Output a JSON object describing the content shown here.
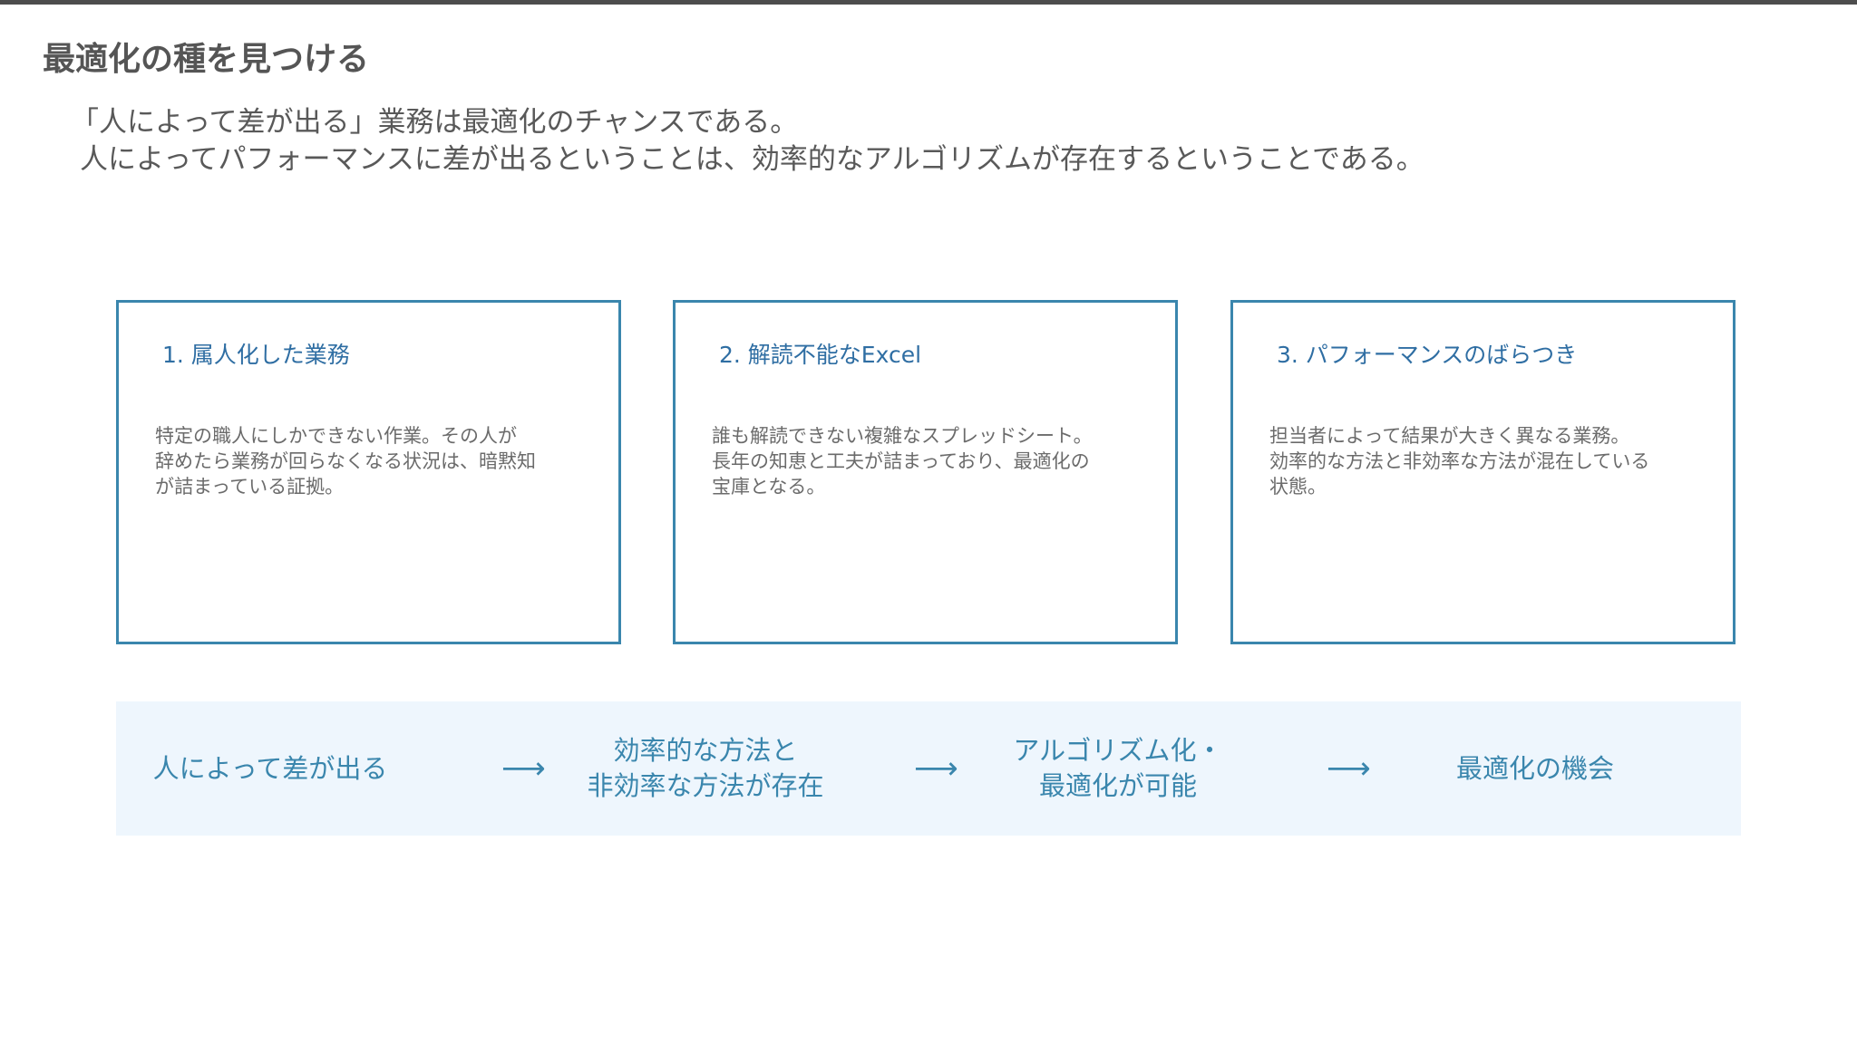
{
  "title": "最適化の種を見つける",
  "lead": {
    "line1": "「人によって差が出る」業務は最適化のチャンスである。",
    "line2": "人によってパフォーマンスに差が出るということは、効率的なアルゴリズムが存在するということである。"
  },
  "cards": [
    {
      "title": "1. 属人化した業務",
      "body": [
        " 特定の職人にしかできない作業。その人が",
        "辞めたら業務が回らなくなる状況は、暗黙知",
        "が詰まっている証拠。"
      ]
    },
    {
      "title": "2. 解読不能なExcel",
      "body": [
        " 誰も解読できない複雑なスプレッドシート。",
        "長年の知恵と工夫が詰まっており、最適化の",
        "宝庫となる。"
      ]
    },
    {
      "title": "3. パフォーマンスのばらつき",
      "body": [
        " 担当者によって結果が大きく異なる業務。",
        "効率的な方法と非効率な方法が混在している",
        "状態。"
      ]
    }
  ],
  "flow": {
    "steps": [
      {
        "lines": [
          "人によって差が出る"
        ]
      },
      {
        "lines": [
          "効率的な方法と",
          "非効率な方法が存在"
        ]
      },
      {
        "lines": [
          "アルゴリズム化・",
          "最適化が可能"
        ]
      },
      {
        "lines": [
          "最適化の機会"
        ]
      }
    ],
    "arrow": "⟶"
  },
  "colors": {
    "accent": "#3a86ad",
    "card_title": "#2f6ea3",
    "flow_background": "#eef6fd",
    "body_text": "#6b6b6b",
    "top_rule": "#4d4d4d"
  }
}
